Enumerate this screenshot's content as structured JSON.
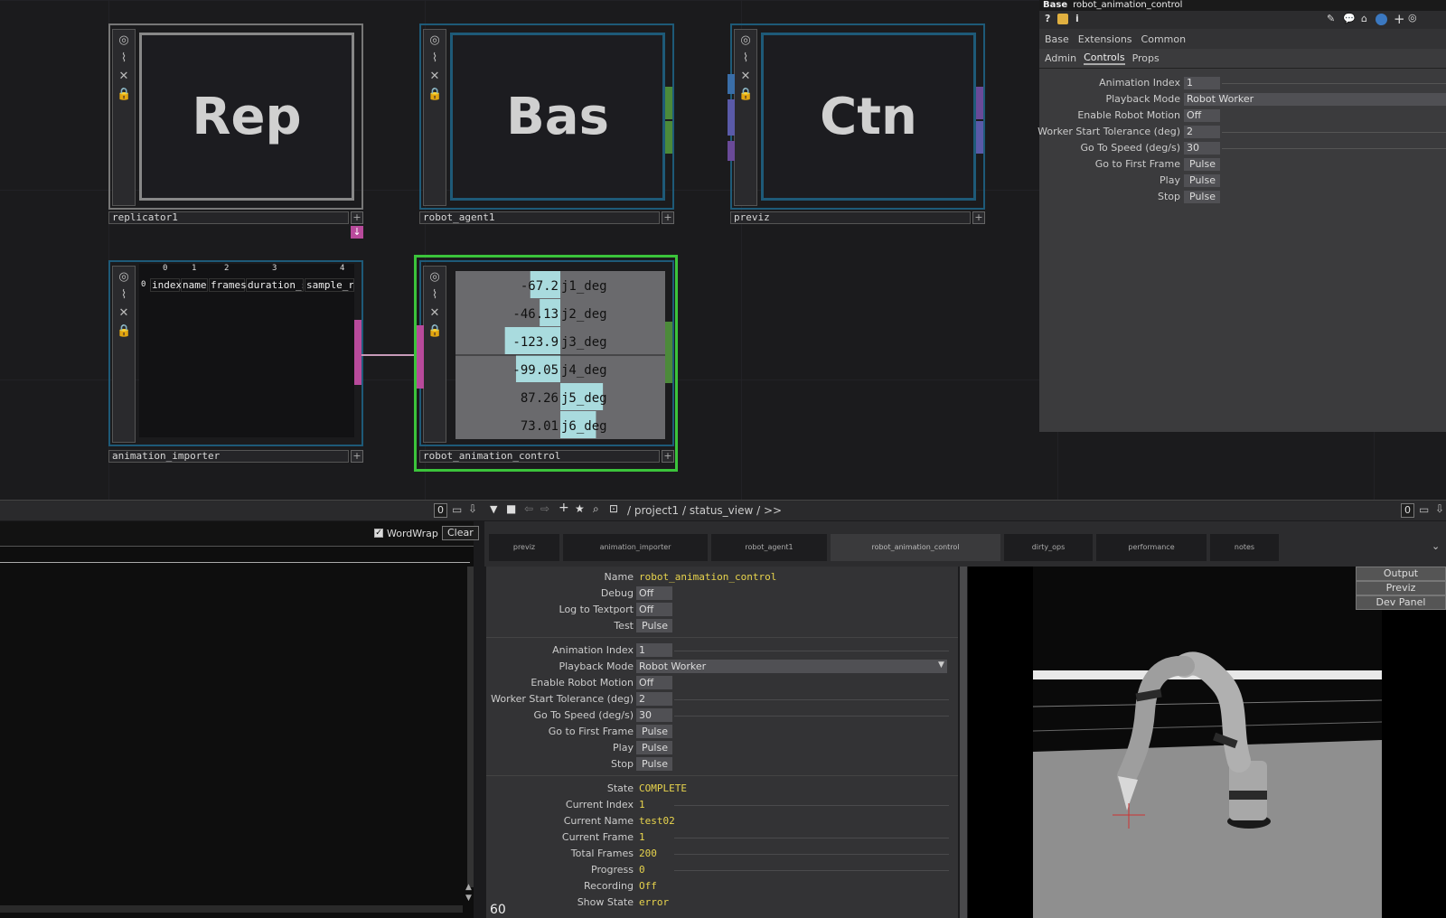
{
  "nodes": [
    {
      "big": "Rep",
      "label": "replicator1"
    },
    {
      "big": "Bas",
      "label": "robot_agent1"
    },
    {
      "big": "Ctn",
      "label": "previz"
    },
    {
      "label": "animation_importer"
    },
    {
      "label": "robot_animation_control"
    }
  ],
  "table": {
    "cols": [
      "0",
      "1",
      "2",
      "3",
      "4"
    ],
    "row": "0",
    "headers": [
      "index",
      "name",
      "frames",
      "duration_s",
      "sample_r"
    ]
  },
  "joints": [
    {
      "value": "-67.2",
      "name": "j1_deg",
      "v": -67.2
    },
    {
      "value": "-46.13",
      "name": "j2_deg",
      "v": -46.13
    },
    {
      "value": "-123.9",
      "name": "j3_deg",
      "v": -123.9
    },
    {
      "value": "-99.05",
      "name": "j4_deg",
      "v": -99.05
    },
    {
      "value": "87.26",
      "name": "j5_deg",
      "v": 87.26
    },
    {
      "value": "73.01",
      "name": "j6_deg",
      "v": 73.01
    }
  ],
  "params": {
    "type": "Base",
    "name": "robot_animation_control",
    "tabs": [
      "Base",
      "Extensions",
      "Common"
    ],
    "subtabs": [
      "Admin",
      "Controls",
      "Props"
    ],
    "rows": [
      {
        "label": "Animation Index",
        "value": "1"
      },
      {
        "label": "Playback Mode",
        "value": "Robot Worker"
      },
      {
        "label": "Enable Robot Motion",
        "value": "Off"
      },
      {
        "label": "Worker Start Tolerance (deg)",
        "value": "2"
      },
      {
        "label": "Go To Speed (deg/s)",
        "value": "30"
      },
      {
        "label": "Go to First Frame",
        "value": "Pulse"
      },
      {
        "label": "Play",
        "value": "Pulse"
      },
      {
        "label": "Stop",
        "value": "Pulse"
      }
    ]
  },
  "pathbar": {
    "num": "0",
    "path": "/ project1 / status_view / >>",
    "num2": "0"
  },
  "textport": {
    "wordwrap": "WordWrap",
    "clear": "Clear"
  },
  "tabs": [
    "previz",
    "animation_importer",
    "robot_agent1",
    "robot_animation_control",
    "dirty_ops",
    "performance",
    "notes"
  ],
  "form": {
    "g1": [
      {
        "label": "Name",
        "value": "robot_animation_control",
        "y": true
      },
      {
        "label": "Debug",
        "value": "Off"
      },
      {
        "label": "Log to Textport",
        "value": "Off"
      },
      {
        "label": "Test",
        "value": "Pulse"
      }
    ],
    "g2": [
      {
        "label": "Animation Index",
        "value": "1"
      },
      {
        "label": "Playback Mode",
        "value": "Robot Worker"
      },
      {
        "label": "Enable Robot Motion",
        "value": "Off"
      },
      {
        "label": "Worker Start Tolerance (deg)",
        "value": "2"
      },
      {
        "label": "Go To Speed (deg/s)",
        "value": "30"
      },
      {
        "label": "Go to First Frame",
        "value": "Pulse"
      },
      {
        "label": "Play",
        "value": "Pulse"
      },
      {
        "label": "Stop",
        "value": "Pulse"
      }
    ],
    "g3": [
      {
        "label": "State",
        "value": "COMPLETE"
      },
      {
        "label": "Current Index",
        "value": "1"
      },
      {
        "label": "Current Name",
        "value": "test02"
      },
      {
        "label": "Current Frame",
        "value": "1"
      },
      {
        "label": "Total Frames",
        "value": "200"
      },
      {
        "label": "Progress",
        "value": "0"
      },
      {
        "label": "Recording",
        "value": "Off"
      },
      {
        "label": "Show State",
        "value": "error"
      }
    ],
    "fps": "60"
  },
  "viewmenu": [
    "Output",
    "Previz",
    "Dev Panel"
  ]
}
